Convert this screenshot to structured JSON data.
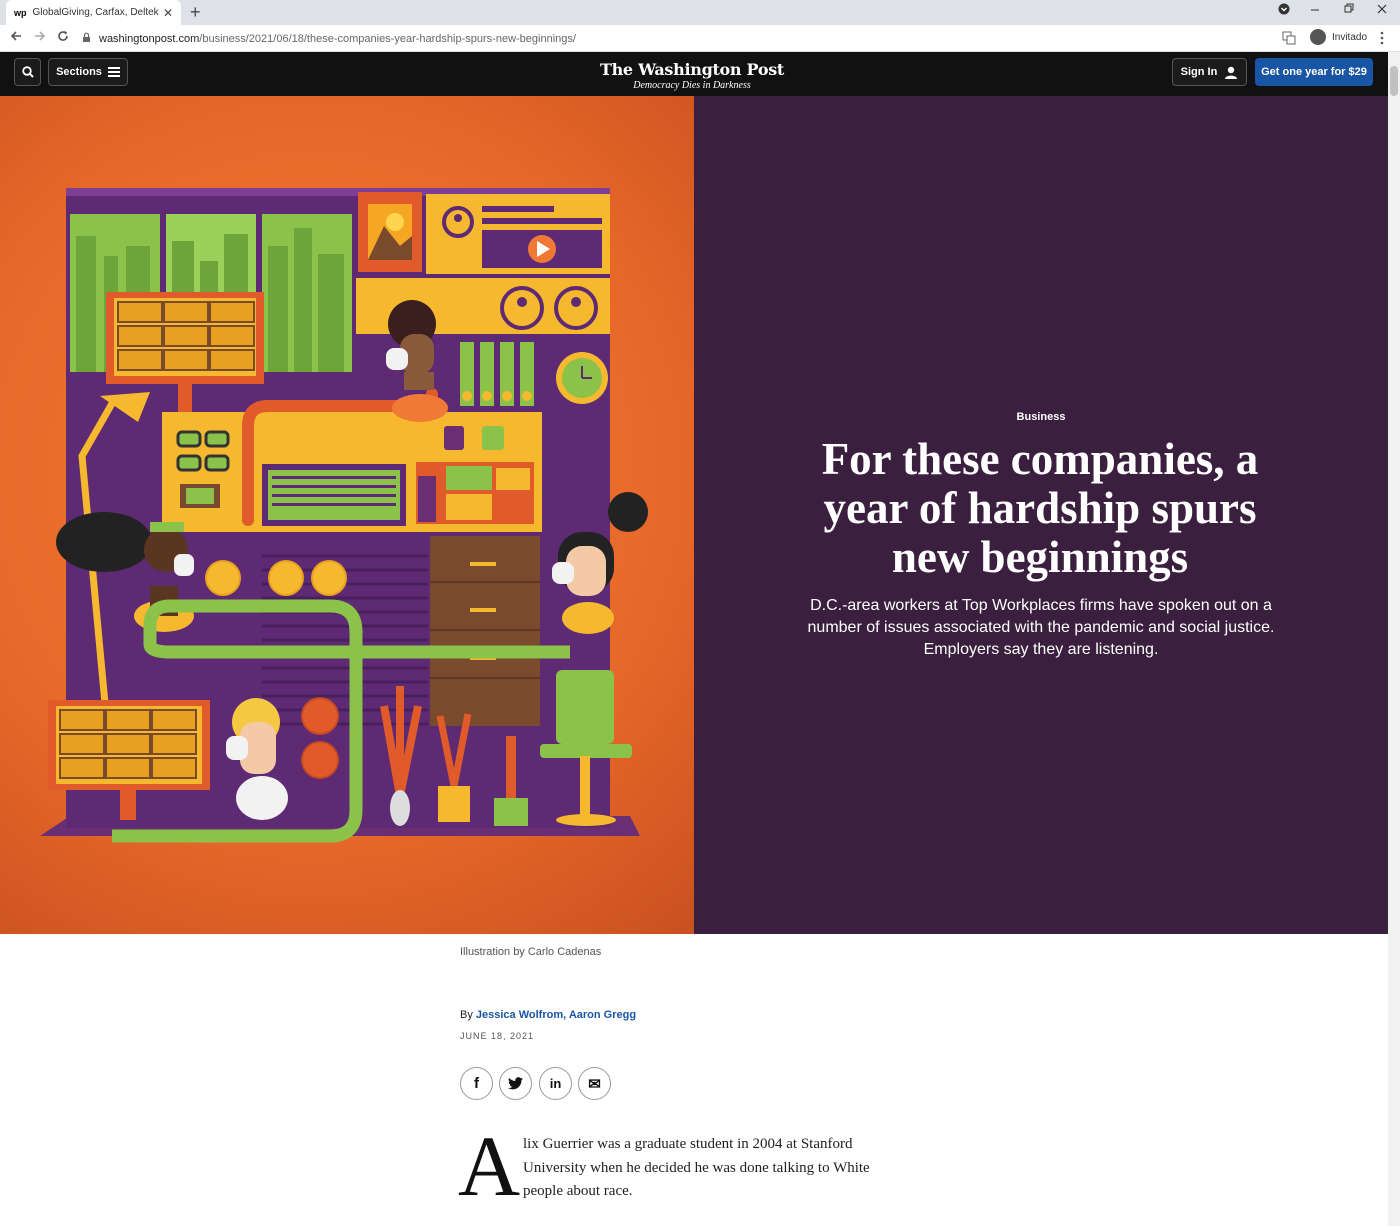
{
  "browser": {
    "tab_favicon": "wp",
    "tab_title": "GlobalGiving, Carfax, Deltek and",
    "close_glyph": "✕",
    "new_tab_glyph": "+",
    "url_domain": "washingtonpost.com",
    "url_path": "/business/2021/06/18/these-companies-year-hardship-spurs-new-beginnings/",
    "profile_label": "Invitado"
  },
  "nav": {
    "sections_label": "Sections",
    "logo_name": "The Washington Post",
    "logo_tagline": "Democracy Dies in Darkness",
    "signin_label": "Sign In",
    "subscribe_label": "Get one year for $29"
  },
  "hero": {
    "kicker": "Business",
    "headline": "For these companies, a year of hardship spurs new beginnings",
    "dek": "D.C.-area workers at Top Workplaces firms have spoken out on a number of issues associated with the pandemic and social justice. Employers say they are listening."
  },
  "article": {
    "caption": "Illustration by Carlo Cadenas",
    "by_prefix": "By ",
    "authors": "Jessica Wolfrom, Aaron Gregg",
    "date": "JUNE 18, 2021",
    "share": {
      "facebook": "f",
      "twitter": "t",
      "linkedin": "in",
      "email": "✉"
    },
    "dropcap": "A",
    "first_paragraph": "lix Guerrier was a graduate student in 2004 at Stanford University when he decided he was done talking to White people about race."
  },
  "colors": {
    "hero_orange": "#e8682a",
    "hero_purple": "#3b1f3e",
    "accent_blue": "#1955a5",
    "nav_black": "#111111"
  }
}
